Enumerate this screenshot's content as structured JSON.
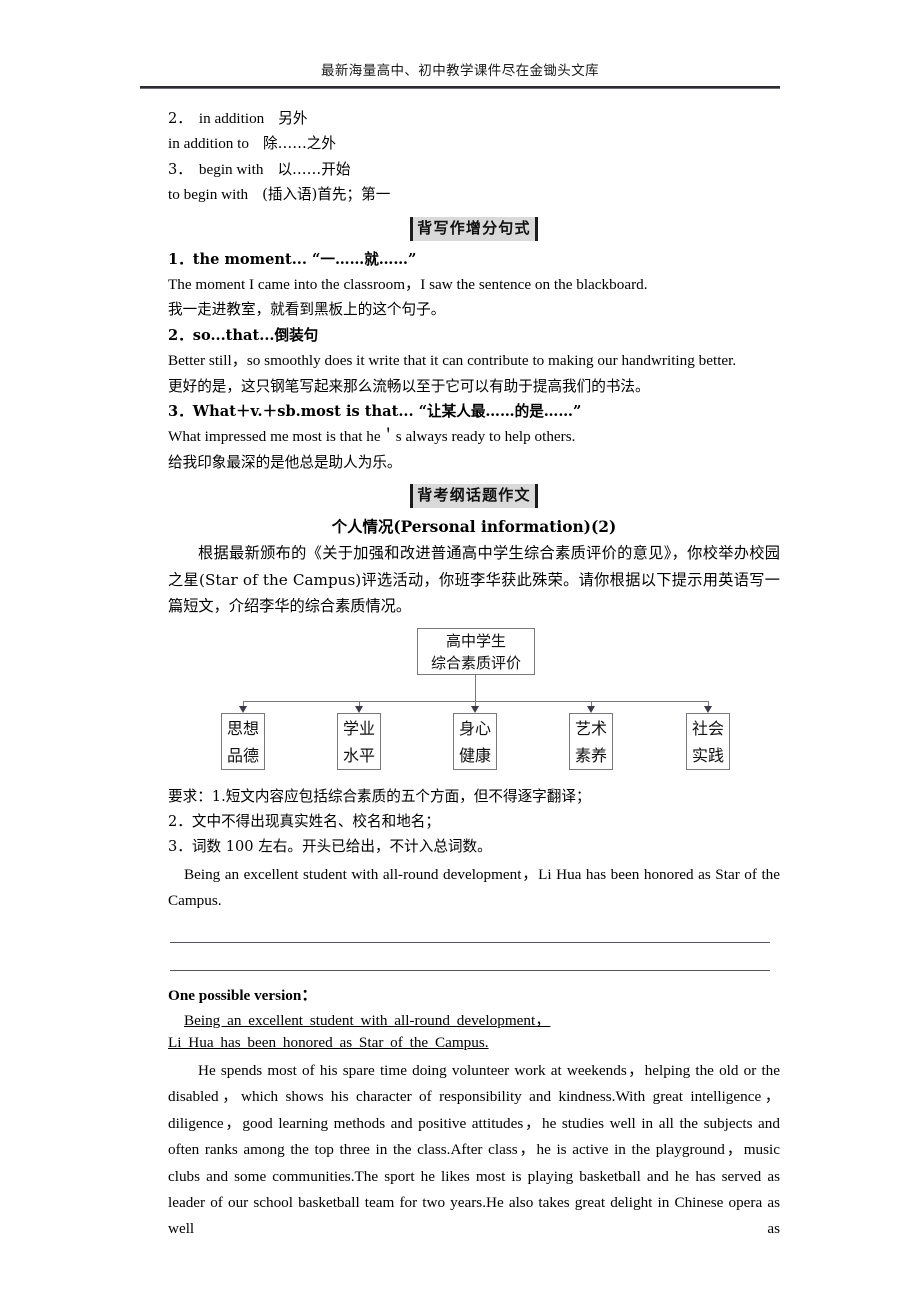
{
  "header": {
    "text": "最新海量高中、初中教学课件尽在金锄头文库"
  },
  "phrases": {
    "items": [
      {
        "num": "2．",
        "term": "in addition",
        "gloss": "另外"
      },
      {
        "num": "",
        "term": "in addition to",
        "gloss": "除……之外"
      },
      {
        "num": "3．",
        "term": "begin with",
        "gloss": "以……开始"
      },
      {
        "num": "",
        "term": "to begin with",
        "gloss": "(插入语)首先；第一"
      }
    ]
  },
  "section_sentences": {
    "banner": "背写作增分句式",
    "items": [
      {
        "heading": "1．the moment... “一……就……”",
        "english": "The moment I came into the classroom，I saw the sentence on the blackboard.",
        "chinese": "我一走进教室，就看到黑板上的这个句子。"
      },
      {
        "heading": "2．so...that...倒装句",
        "english": "Better still，so smoothly does it write that it can contribute to making our handwriting better.",
        "chinese": "更好的是，这只钢笔写起来那么流畅以至于它可以有助于提高我们的书法。"
      },
      {
        "heading": "3．What＋v.＋sb.most is that... “让某人最……的是……”",
        "english": "What impressed me most is that he＇s always ready to help others.",
        "chinese": "给我印象最深的是他总是助人为乐。"
      }
    ]
  },
  "section_composition": {
    "banner": "背考纲话题作文",
    "title": "个人情况(Personal information)(2)",
    "prompt": "根据最新颁布的《关于加强和改进普通高中学生综合素质评价的意见》，你校举办校园之星(Star of the Campus)评选活动，你班李华获此殊荣。请你根据以下提示用英语写一篇短文，介绍李华的综合素质情况。",
    "diagram": {
      "root": {
        "line1": "高中学生",
        "line2": "综合素质评价"
      },
      "leaves": [
        {
          "line1": "思想",
          "line2": "品德"
        },
        {
          "line1": "学业",
          "line2": "水平"
        },
        {
          "line1": "身心",
          "line2": "健康"
        },
        {
          "line1": "艺术",
          "line2": "素养"
        },
        {
          "line1": "社会",
          "line2": "实践"
        }
      ]
    },
    "requirements": [
      "要求：1.短文内容应包括综合素质的五个方面，但不得逐字翻译；",
      "2．文中不得出现真实姓名、校名和地名；",
      "3．词数 100 左右。开头已给出，不计入总词数。"
    ],
    "given_opening": "Being an excellent student with all‐round development，Li Hua has been honored as Star of the Campus."
  },
  "answer": {
    "label": "One possible version：",
    "opening_line1": "Being an excellent student with all‐round development，",
    "opening_line2": "Li Hua has been honored as Star of the Campus.",
    "body": "He spends most of his spare time doing volunteer work at weekends，helping the old or the disabled，which shows his character of responsibility and kindness.With great intelligence，diligence，good learning methods and positive attitudes，he studies well in all the subjects and often ranks among the top three in the class.After class，he is active in the playground，music clubs and some communities.The sport he likes most is playing basketball and he has served as leader of our school basketball team for two years.He also takes great delight in Chinese opera as well as"
  }
}
